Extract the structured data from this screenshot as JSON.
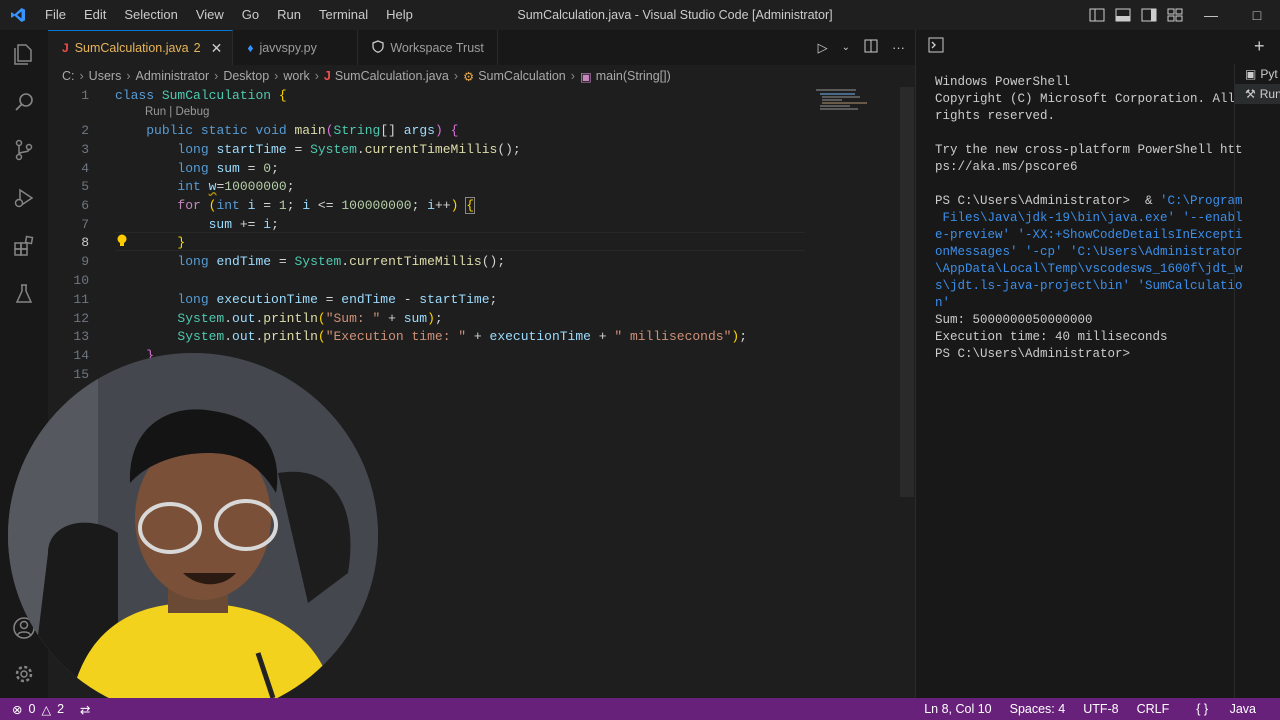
{
  "titlebar": {
    "menu": [
      "File",
      "Edit",
      "Selection",
      "View",
      "Go",
      "Run",
      "Terminal",
      "Help"
    ],
    "title": "SumCalculation.java - Visual Studio Code [Administrator]"
  },
  "tabs": [
    {
      "label": "SumCalculation.java",
      "badge": "2",
      "icon": "J",
      "active": true
    },
    {
      "label": "javvspy.py",
      "icon": "python-icon",
      "active": false
    },
    {
      "label": "Workspace Trust",
      "icon": "shield-icon",
      "active": false
    }
  ],
  "breadcrumb": [
    "C:",
    "Users",
    "Administrator",
    "Desktop",
    "work",
    "SumCalculation.java",
    "SumCalculation",
    "main(String[])"
  ],
  "editor": {
    "codelens": "Run | Debug",
    "line_numbers": [
      "1",
      "2",
      "3",
      "4",
      "5",
      "6",
      "7",
      "8",
      "9",
      "10",
      "11",
      "12",
      "13",
      "14",
      "15"
    ],
    "cursor_line": "8"
  },
  "terminal": {
    "lines": [
      "Windows PowerShell",
      "Copyright (C) Microsoft Corporation. All",
      "rights reserved.",
      "",
      "Try the new cross-platform PowerShell htt",
      "ps://aka.ms/pscore6",
      "",
      "PS C:\\Users\\Administrator>  & 'C:\\Program",
      " Files\\Java\\jdk-19\\bin\\java.exe' '--enabl",
      "e-preview' '-XX:+ShowCodeDetailsInExcepti",
      "onMessages' '-cp' 'C:\\Users\\Administrator",
      "\\AppData\\Local\\Temp\\vscodesws_1600f\\jdt_w",
      "s\\jdt.ls-java-project\\bin' 'SumCalculatio",
      "n'",
      "Sum: 5000000050000000",
      "Execution time: 40 milliseconds",
      "PS C:\\Users\\Administrator> "
    ],
    "list": [
      "Pyt",
      "Run"
    ]
  },
  "statusbar": {
    "errors": "0",
    "warnings": "2",
    "position": "Ln 8, Col 10",
    "spaces": "Spaces: 4",
    "encoding": "UTF-8",
    "eol": "CRLF",
    "language": "Java"
  },
  "colors": {
    "statusbar": "#68217a",
    "accent": "#0078d4",
    "tab_active_text": "#e8b55a"
  }
}
